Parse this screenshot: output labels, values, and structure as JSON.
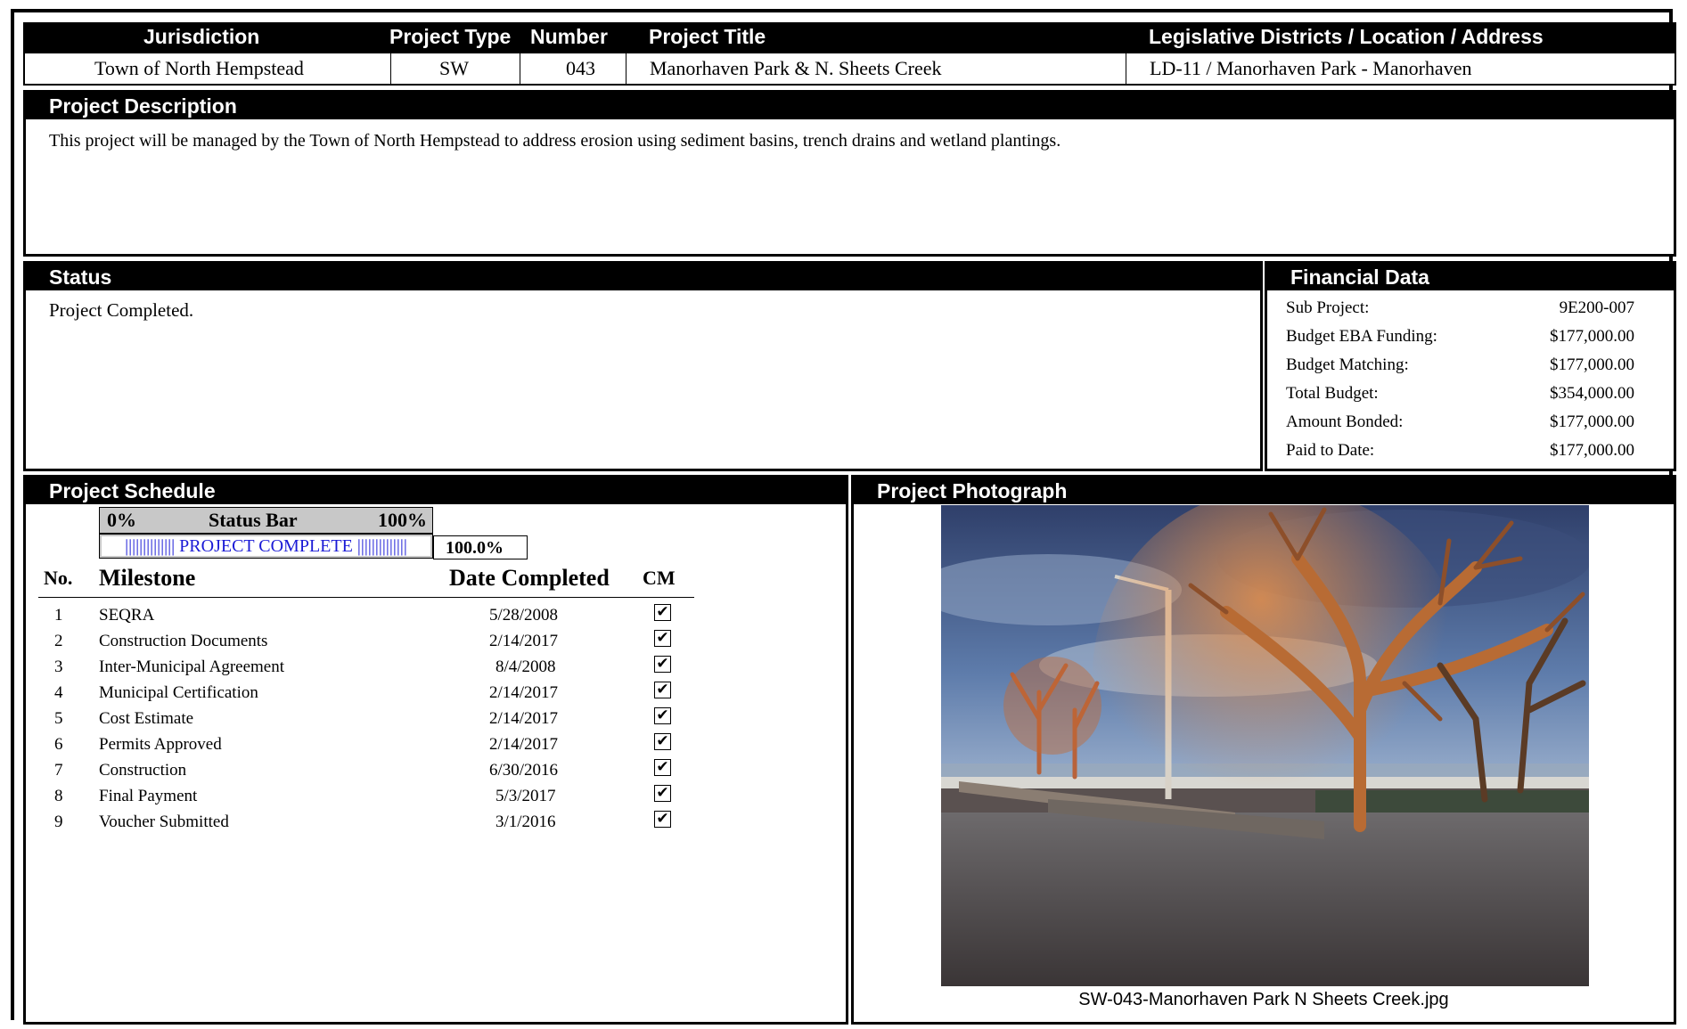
{
  "project_header": {
    "columns": [
      "Jurisdiction",
      "Project Type",
      "Number",
      "Project Title",
      "Legislative Districts / Location / Address"
    ],
    "values": [
      "Town of North Hempstead",
      "SW",
      "043",
      "Manorhaven Park & N. Sheets Creek",
      "LD-11 / Manorhaven Park - Manorhaven"
    ]
  },
  "description": {
    "heading": "Project Description",
    "text": "This project will be managed by the Town of North Hempstead to address erosion using sediment basins, trench drains and wetland plantings."
  },
  "status": {
    "heading": "Status",
    "text": "Project Completed."
  },
  "financial": {
    "heading": "Financial Data",
    "rows": [
      {
        "label": "Sub Project:",
        "value": "9E200-007"
      },
      {
        "label": "Budget EBA Funding:",
        "value": "$177,000.00"
      },
      {
        "label": "Budget Matching:",
        "value": "$177,000.00"
      },
      {
        "label": "Total Budget:",
        "value": "$354,000.00"
      },
      {
        "label": "Amount Bonded:",
        "value": "$177,000.00"
      },
      {
        "label": "Paid to Date:",
        "value": "$177,000.00"
      }
    ]
  },
  "schedule": {
    "heading": "Project Schedule",
    "status_bar": {
      "left_label": "0%",
      "center_label": "Status Bar",
      "right_label": "100%",
      "bar_text": "|||||||||||||| PROJECT COMPLETE ||||||||||||||",
      "percent_text": "100.0%",
      "progress": 1.0
    },
    "columns": {
      "no": "No.",
      "milestone": "Milestone",
      "date": "Date Completed",
      "cm": "CM"
    },
    "check_glyph": "✔",
    "milestones": [
      {
        "no": "1",
        "name": "SEQRA",
        "date": "5/28/2008",
        "cm": true
      },
      {
        "no": "2",
        "name": "Construction Documents",
        "date": "2/14/2017",
        "cm": true
      },
      {
        "no": "3",
        "name": "Inter-Municipal Agreement",
        "date": "8/4/2008",
        "cm": true
      },
      {
        "no": "4",
        "name": "Municipal Certification",
        "date": "2/14/2017",
        "cm": true
      },
      {
        "no": "5",
        "name": "Cost Estimate",
        "date": "2/14/2017",
        "cm": true
      },
      {
        "no": "6",
        "name": "Permits Approved",
        "date": "2/14/2017",
        "cm": true
      },
      {
        "no": "7",
        "name": "Construction",
        "date": "6/30/2016",
        "cm": true
      },
      {
        "no": "8",
        "name": "Final Payment",
        "date": "5/3/2017",
        "cm": true
      },
      {
        "no": "9",
        "name": "Voucher Submitted",
        "date": "3/1/2016",
        "cm": true
      }
    ]
  },
  "photo": {
    "heading": "Project Photograph",
    "caption": "SW-043-Manorhaven Park N Sheets Creek.jpg"
  }
}
